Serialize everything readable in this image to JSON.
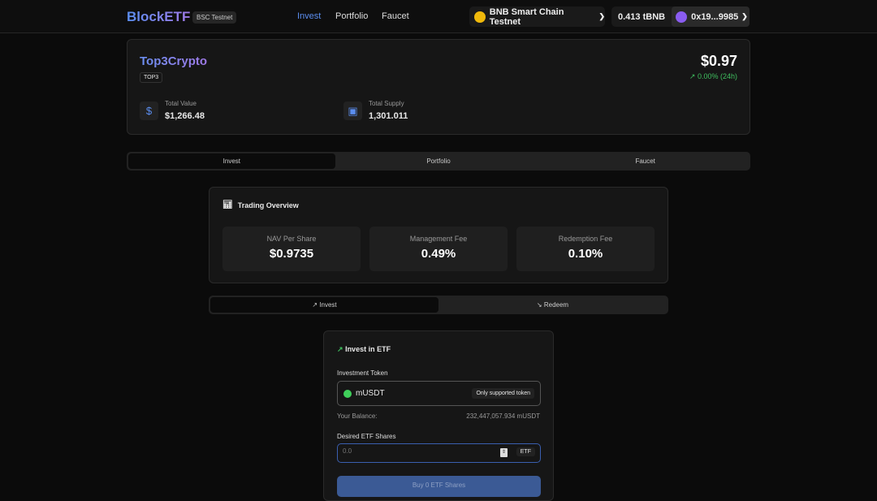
{
  "nav": {
    "logo": "BlockETF",
    "network_badge": "BSC Testnet",
    "links": [
      "Invest",
      "Portfolio",
      "Faucet"
    ],
    "chain": "BNB Smart Chain Testnet",
    "balance": "0.413 tBNB",
    "address": "0x19...9985"
  },
  "fund": {
    "name": "Top3Crypto",
    "symbol": "TOP3",
    "price": "$0.97",
    "change": "0.00% (24h)",
    "total_value_label": "Total Value",
    "total_value": "$1,266.48",
    "total_supply_label": "Total Supply",
    "total_supply": "1,301.011"
  },
  "main_tabs": [
    "Invest",
    "Portfolio",
    "Faucet"
  ],
  "overview": {
    "title": "Trading Overview",
    "stats": [
      {
        "label": "NAV Per Share",
        "value": "$0.9735"
      },
      {
        "label": "Management Fee",
        "value": "0.49%"
      },
      {
        "label": "Redemption Fee",
        "value": "0.10%"
      }
    ]
  },
  "mode_tabs": [
    "Invest",
    "Redeem"
  ],
  "invest": {
    "title": "Invest in ETF",
    "token_label": "Investment Token",
    "token": "mUSDT",
    "token_note": "Only supported token",
    "balance_label": "Your Balance:",
    "balance": "232,447,057.934 mUSDT",
    "shares_label": "Desired ETF Shares",
    "shares_placeholder": "0.0",
    "shares_unit": "ETF",
    "buy_button": "Buy 0 ETF Shares"
  },
  "colors": {
    "accent": "#5b8ef0",
    "positive": "#3fbf5f",
    "token_dot": "#3fcf5a"
  }
}
